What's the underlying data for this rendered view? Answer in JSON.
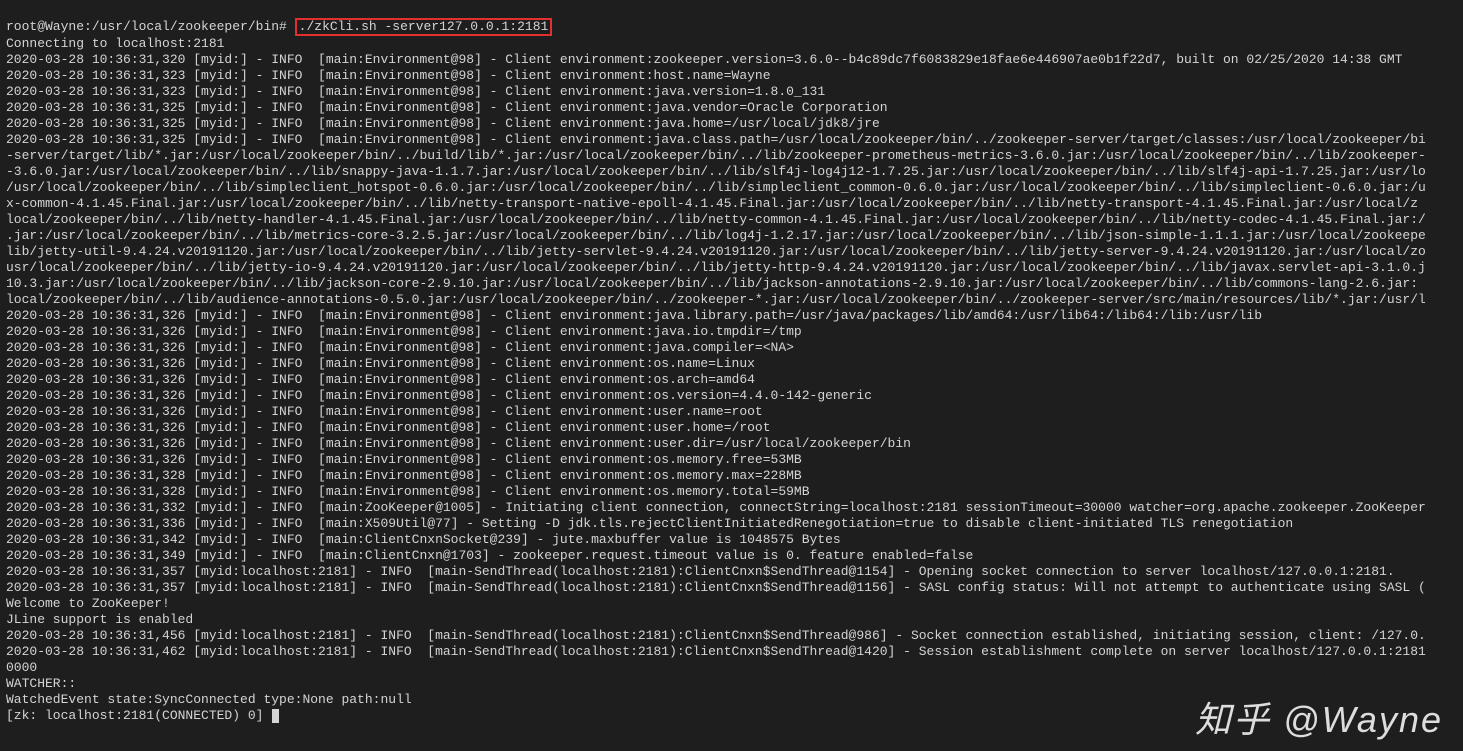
{
  "prompt": {
    "prefix": "root@Wayne:/usr/local/zookeeper/bin#",
    "command": "./zkCli.sh -server127.0.0.1:2181"
  },
  "lines": [
    "Connecting to localhost:2181",
    "2020-03-28 10:36:31,320 [myid:] - INFO  [main:Environment@98] - Client environment:zookeeper.version=3.6.0--b4c89dc7f6083829e18fae6e446907ae0b1f22d7, built on 02/25/2020 14:38 GMT",
    "2020-03-28 10:36:31,323 [myid:] - INFO  [main:Environment@98] - Client environment:host.name=Wayne",
    "2020-03-28 10:36:31,323 [myid:] - INFO  [main:Environment@98] - Client environment:java.version=1.8.0_131",
    "2020-03-28 10:36:31,325 [myid:] - INFO  [main:Environment@98] - Client environment:java.vendor=Oracle Corporation",
    "2020-03-28 10:36:31,325 [myid:] - INFO  [main:Environment@98] - Client environment:java.home=/usr/local/jdk8/jre",
    "2020-03-28 10:36:31,325 [myid:] - INFO  [main:Environment@98] - Client environment:java.class.path=/usr/local/zookeeper/bin/../zookeeper-server/target/classes:/usr/local/zookeeper/bi",
    "-server/target/lib/*.jar:/usr/local/zookeeper/bin/../build/lib/*.jar:/usr/local/zookeeper/bin/../lib/zookeeper-prometheus-metrics-3.6.0.jar:/usr/local/zookeeper/bin/../lib/zookeeper-",
    "-3.6.0.jar:/usr/local/zookeeper/bin/../lib/snappy-java-1.1.7.jar:/usr/local/zookeeper/bin/../lib/slf4j-log4j12-1.7.25.jar:/usr/local/zookeeper/bin/../lib/slf4j-api-1.7.25.jar:/usr/lo",
    "/usr/local/zookeeper/bin/../lib/simpleclient_hotspot-0.6.0.jar:/usr/local/zookeeper/bin/../lib/simpleclient_common-0.6.0.jar:/usr/local/zookeeper/bin/../lib/simpleclient-0.6.0.jar:/u",
    "x-common-4.1.45.Final.jar:/usr/local/zookeeper/bin/../lib/netty-transport-native-epoll-4.1.45.Final.jar:/usr/local/zookeeper/bin/../lib/netty-transport-4.1.45.Final.jar:/usr/local/z",
    "local/zookeeper/bin/../lib/netty-handler-4.1.45.Final.jar:/usr/local/zookeeper/bin/../lib/netty-common-4.1.45.Final.jar:/usr/local/zookeeper/bin/../lib/netty-codec-4.1.45.Final.jar:/",
    ".jar:/usr/local/zookeeper/bin/../lib/metrics-core-3.2.5.jar:/usr/local/zookeeper/bin/../lib/log4j-1.2.17.jar:/usr/local/zookeeper/bin/../lib/json-simple-1.1.1.jar:/usr/local/zookeepe",
    "lib/jetty-util-9.4.24.v20191120.jar:/usr/local/zookeeper/bin/../lib/jetty-servlet-9.4.24.v20191120.jar:/usr/local/zookeeper/bin/../lib/jetty-server-9.4.24.v20191120.jar:/usr/local/zo",
    "usr/local/zookeeper/bin/../lib/jetty-io-9.4.24.v20191120.jar:/usr/local/zookeeper/bin/../lib/jetty-http-9.4.24.v20191120.jar:/usr/local/zookeeper/bin/../lib/javax.servlet-api-3.1.0.j",
    "10.3.jar:/usr/local/zookeeper/bin/../lib/jackson-core-2.9.10.jar:/usr/local/zookeeper/bin/../lib/jackson-annotations-2.9.10.jar:/usr/local/zookeeper/bin/../lib/commons-lang-2.6.jar:",
    "local/zookeeper/bin/../lib/audience-annotations-0.5.0.jar:/usr/local/zookeeper/bin/../zookeeper-*.jar:/usr/local/zookeeper/bin/../zookeeper-server/src/main/resources/lib/*.jar:/usr/l",
    "2020-03-28 10:36:31,326 [myid:] - INFO  [main:Environment@98] - Client environment:java.library.path=/usr/java/packages/lib/amd64:/usr/lib64:/lib64:/lib:/usr/lib",
    "2020-03-28 10:36:31,326 [myid:] - INFO  [main:Environment@98] - Client environment:java.io.tmpdir=/tmp",
    "2020-03-28 10:36:31,326 [myid:] - INFO  [main:Environment@98] - Client environment:java.compiler=<NA>",
    "2020-03-28 10:36:31,326 [myid:] - INFO  [main:Environment@98] - Client environment:os.name=Linux",
    "2020-03-28 10:36:31,326 [myid:] - INFO  [main:Environment@98] - Client environment:os.arch=amd64",
    "2020-03-28 10:36:31,326 [myid:] - INFO  [main:Environment@98] - Client environment:os.version=4.4.0-142-generic",
    "2020-03-28 10:36:31,326 [myid:] - INFO  [main:Environment@98] - Client environment:user.name=root",
    "2020-03-28 10:36:31,326 [myid:] - INFO  [main:Environment@98] - Client environment:user.home=/root",
    "2020-03-28 10:36:31,326 [myid:] - INFO  [main:Environment@98] - Client environment:user.dir=/usr/local/zookeeper/bin",
    "2020-03-28 10:36:31,326 [myid:] - INFO  [main:Environment@98] - Client environment:os.memory.free=53MB",
    "2020-03-28 10:36:31,328 [myid:] - INFO  [main:Environment@98] - Client environment:os.memory.max=228MB",
    "2020-03-28 10:36:31,328 [myid:] - INFO  [main:Environment@98] - Client environment:os.memory.total=59MB",
    "2020-03-28 10:36:31,332 [myid:] - INFO  [main:ZooKeeper@1005] - Initiating client connection, connectString=localhost:2181 sessionTimeout=30000 watcher=org.apache.zookeeper.ZooKeeper",
    "2020-03-28 10:36:31,336 [myid:] - INFO  [main:X509Util@77] - Setting -D jdk.tls.rejectClientInitiatedRenegotiation=true to disable client-initiated TLS renegotiation",
    "2020-03-28 10:36:31,342 [myid:] - INFO  [main:ClientCnxnSocket@239] - jute.maxbuffer value is 1048575 Bytes",
    "2020-03-28 10:36:31,349 [myid:] - INFO  [main:ClientCnxn@1703] - zookeeper.request.timeout value is 0. feature enabled=false",
    "2020-03-28 10:36:31,357 [myid:localhost:2181] - INFO  [main-SendThread(localhost:2181):ClientCnxn$SendThread@1154] - Opening socket connection to server localhost/127.0.0.1:2181.",
    "2020-03-28 10:36:31,357 [myid:localhost:2181] - INFO  [main-SendThread(localhost:2181):ClientCnxn$SendThread@1156] - SASL config status: Will not attempt to authenticate using SASL (",
    "Welcome to ZooKeeper!",
    "JLine support is enabled",
    "2020-03-28 10:36:31,456 [myid:localhost:2181] - INFO  [main-SendThread(localhost:2181):ClientCnxn$SendThread@986] - Socket connection established, initiating session, client: /127.0.",
    "2020-03-28 10:36:31,462 [myid:localhost:2181] - INFO  [main-SendThread(localhost:2181):ClientCnxn$SendThread@1420] - Session establishment complete on server localhost/127.0.0.1:2181",
    "0000",
    "",
    "WATCHER::",
    "",
    "WatchedEvent state:SyncConnected type:None path:null"
  ],
  "zk_prompt": "[zk: localhost:2181(CONNECTED) 0] ",
  "watermark": "知乎 @Wayne"
}
